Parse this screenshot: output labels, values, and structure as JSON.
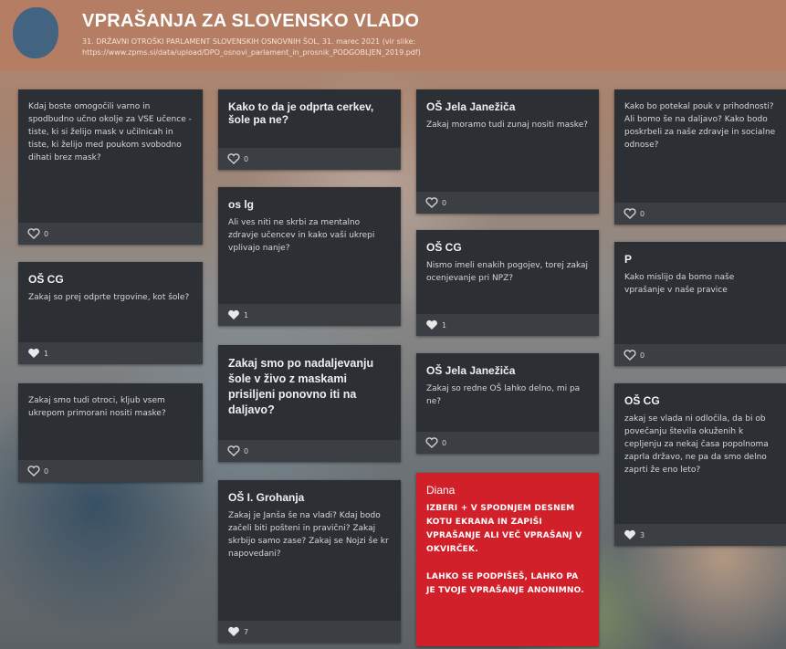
{
  "header": {
    "title": "VPRAŠANJA ZA SLOVENSKO VLADO",
    "subtitle_line1": "31. DRŽAVNI OTROŠKI PARLAMENT SLOVENSKIH OSNOVNIH ŠOL, 31. marec 2021 (vir slike:",
    "subtitle_line2": "https://www.zpms.si/data/upload/DPO_osnovi_parlament_in_prosnik_PODGOBLJEN_2019.pdf)"
  },
  "posts": [
    {
      "author": "",
      "text": "Kdaj boste omogočili varno in spodbudno učno okolje za VSE učence - tiste, ki si želijo mask v učilnicah in tiste, ki želijo med poukom svobodno dihati brez mask?",
      "likes": "0"
    },
    {
      "author": "Kako to da je odprta cerkev, šole pa ne?",
      "text": "",
      "likes": "0"
    },
    {
      "author": "OŠ Jela Janežiča",
      "text": "Zakaj moramo tudi zunaj nositi maske?",
      "likes": "0"
    },
    {
      "author": "",
      "text": "Kako bo potekal pouk v prihodnosti? Ali bomo še na daljavo? Kako bodo poskrbeli za naše zdravje in socialne odnose?",
      "likes": "0"
    },
    {
      "author": "os lg",
      "text": "Ali ves niti ne skrbi za mentalno zdravje učencev in kako vaši ukrepi vplivajo nanje?",
      "likes": "1"
    },
    {
      "author": "OŠ CG",
      "text": "Zakaj so prej odprte trgovine, kot šole?",
      "likes": "1"
    },
    {
      "author": "OŠ CG",
      "text": "Nismo imeli enakih pogojev, torej zakaj ocenjevanje pri NPZ?",
      "likes": "1"
    },
    {
      "author": "P",
      "text": "Kako mislijo da bomo naše vprašanje v naše pravice",
      "likes": "0"
    },
    {
      "author": "",
      "text": "Zakaj smo tudi otroci, kljub vsem ukrepom primorani nositi maske?",
      "likes": "0"
    },
    {
      "author": "Zakaj smo po nadaljevanju šole v živo z maskami prisiljeni ponovno iti na daljavo?",
      "text": "",
      "likes": "0"
    },
    {
      "author": "OŠ Jela Janežiča",
      "text": "Zakaj so redne OŠ lahko delno, mi pa ne?",
      "likes": "0"
    },
    {
      "author": "OŠ CG",
      "text": "zakaj se vlada ni odločila, da bi ob povečanju števila okuženih k cepljenju za nekaj časa popolnoma zaprla državo, ne pa da smo delno zaprti že eno leto?",
      "likes": "3"
    },
    {
      "author": "OŠ I. Grohanja",
      "text": "Zakaj je Janša še na vladi? Kdaj bodo začeli biti pošteni in pravični? Zakaj skrbijo samo zase? Zakaj se Nojzi še kr napovedani?",
      "likes": "7"
    },
    {
      "author": "Diana",
      "text": "IZBERI + V SPODNJEM DESNEM KOTU EKRANA IN ZAPIŠI VPRAŠANJE ALI VEČ VPRAŠANJ V OKVIRČEK.\n\nLAHKO SE PODPIŠEŠ, LAHKO PA JE TVOJE VPRAŠANJE ANONIMNO.",
      "likes": ""
    }
  ],
  "colors": {
    "header_bg": "#b57d63",
    "card_bg": "#2c2f33",
    "card_footer": "#3b3f44",
    "accent_red": "#d1202a"
  },
  "icons": {
    "like": "heart-icon",
    "logo": "padlet-logo-icon"
  }
}
